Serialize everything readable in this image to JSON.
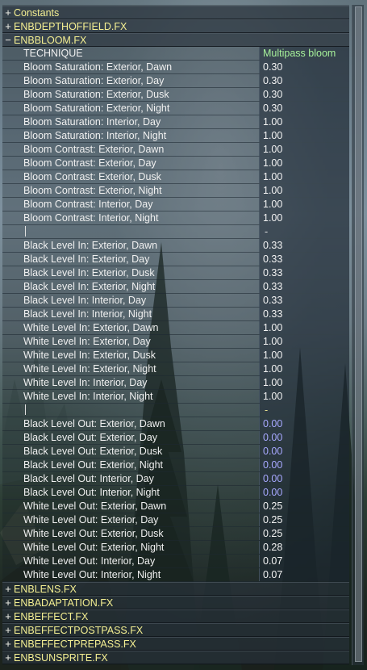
{
  "sections_top": [
    {
      "sign": "+",
      "label": "Constants"
    },
    {
      "sign": "+",
      "label": "ENBDEPTHOFFIELD.FX"
    }
  ],
  "open_section": {
    "sign": "−",
    "label": "ENBBLOOM.FX"
  },
  "params": [
    {
      "name": "TECHNIQUE",
      "value": "Multipass bloom",
      "style": "tech"
    },
    {
      "name": "Bloom Saturation: Exterior, Dawn",
      "value": "0.30"
    },
    {
      "name": "Bloom Saturation: Exterior, Day",
      "value": "0.30"
    },
    {
      "name": "Bloom Saturation: Exterior, Dusk",
      "value": "0.30"
    },
    {
      "name": "Bloom Saturation: Exterior, Night",
      "value": "0.30"
    },
    {
      "name": "Bloom Saturation: Interior, Day",
      "value": "1.00"
    },
    {
      "name": "Bloom Saturation: Interior, Night",
      "value": "1.00"
    },
    {
      "name": "Bloom Contrast: Exterior, Dawn",
      "value": "1.00"
    },
    {
      "name": "Bloom Contrast: Exterior, Day",
      "value": "1.00"
    },
    {
      "name": "Bloom Contrast: Exterior, Dusk",
      "value": "1.00"
    },
    {
      "name": "Bloom Contrast: Exterior, Night",
      "value": "1.00"
    },
    {
      "name": "Bloom Contrast: Interior, Day",
      "value": "1.00"
    },
    {
      "name": "Bloom Contrast: Interior, Night",
      "value": "1.00"
    },
    {
      "name": "|",
      "value": "-",
      "style": "sep"
    },
    {
      "name": "Black Level In: Exterior, Dawn",
      "value": "0.33"
    },
    {
      "name": "Black Level In: Exterior, Day",
      "value": "0.33"
    },
    {
      "name": "Black Level In: Exterior, Dusk",
      "value": "0.33"
    },
    {
      "name": "Black Level In: Exterior, Night",
      "value": "0.33"
    },
    {
      "name": "Black Level In: Interior, Day",
      "value": "0.33"
    },
    {
      "name": "Black Level In: Interior, Night",
      "value": "0.33"
    },
    {
      "name": "White Level In: Exterior, Dawn",
      "value": "1.00"
    },
    {
      "name": "White Level In: Exterior, Day",
      "value": "1.00"
    },
    {
      "name": "White Level In: Exterior, Dusk",
      "value": "1.00"
    },
    {
      "name": "White Level In: Exterior, Night",
      "value": "1.00"
    },
    {
      "name": "White Level In: Interior, Day",
      "value": "1.00"
    },
    {
      "name": "White Level In: Interior, Night",
      "value": "1.00"
    },
    {
      "name": "|",
      "value": "-",
      "style": "sep-y"
    },
    {
      "name": "Black Level Out: Exterior, Dawn",
      "value": "0.00",
      "style": "blue"
    },
    {
      "name": "Black Level Out: Exterior, Day",
      "value": "0.00",
      "style": "blue"
    },
    {
      "name": "Black Level Out: Exterior, Dusk",
      "value": "0.00",
      "style": "blue"
    },
    {
      "name": "Black Level Out: Exterior, Night",
      "value": "0.00",
      "style": "blue"
    },
    {
      "name": "Black Level Out: Interior, Day",
      "value": "0.00",
      "style": "blue"
    },
    {
      "name": "Black Level Out: Interior, Night",
      "value": "0.00",
      "style": "blue"
    },
    {
      "name": "White Level Out: Exterior, Dawn",
      "value": "0.25"
    },
    {
      "name": "White Level Out: Exterior, Day",
      "value": "0.25"
    },
    {
      "name": "White Level Out: Exterior, Dusk",
      "value": "0.25"
    },
    {
      "name": "White Level Out: Exterior, Night",
      "value": "0.28"
    },
    {
      "name": "White Level Out: Interior, Day",
      "value": "0.07"
    },
    {
      "name": "White Level Out: Interior, Night",
      "value": "0.07"
    }
  ],
  "sections_bottom": [
    {
      "sign": "+",
      "label": "ENBLENS.FX"
    },
    {
      "sign": "+",
      "label": "ENBADAPTATION.FX"
    },
    {
      "sign": "+",
      "label": "ENBEFFECT.FX"
    },
    {
      "sign": "+",
      "label": "ENBEFFECTPOSTPASS.FX"
    },
    {
      "sign": "+",
      "label": "ENBEFFECTPREPASS.FX"
    },
    {
      "sign": "+",
      "label": "ENBSUNSPRITE.FX"
    }
  ],
  "colors": {
    "section_label": "#f4ef92",
    "technique_value": "#a6f09a",
    "zero_value": "#a7a8ff",
    "text": "#f0f0f0"
  }
}
